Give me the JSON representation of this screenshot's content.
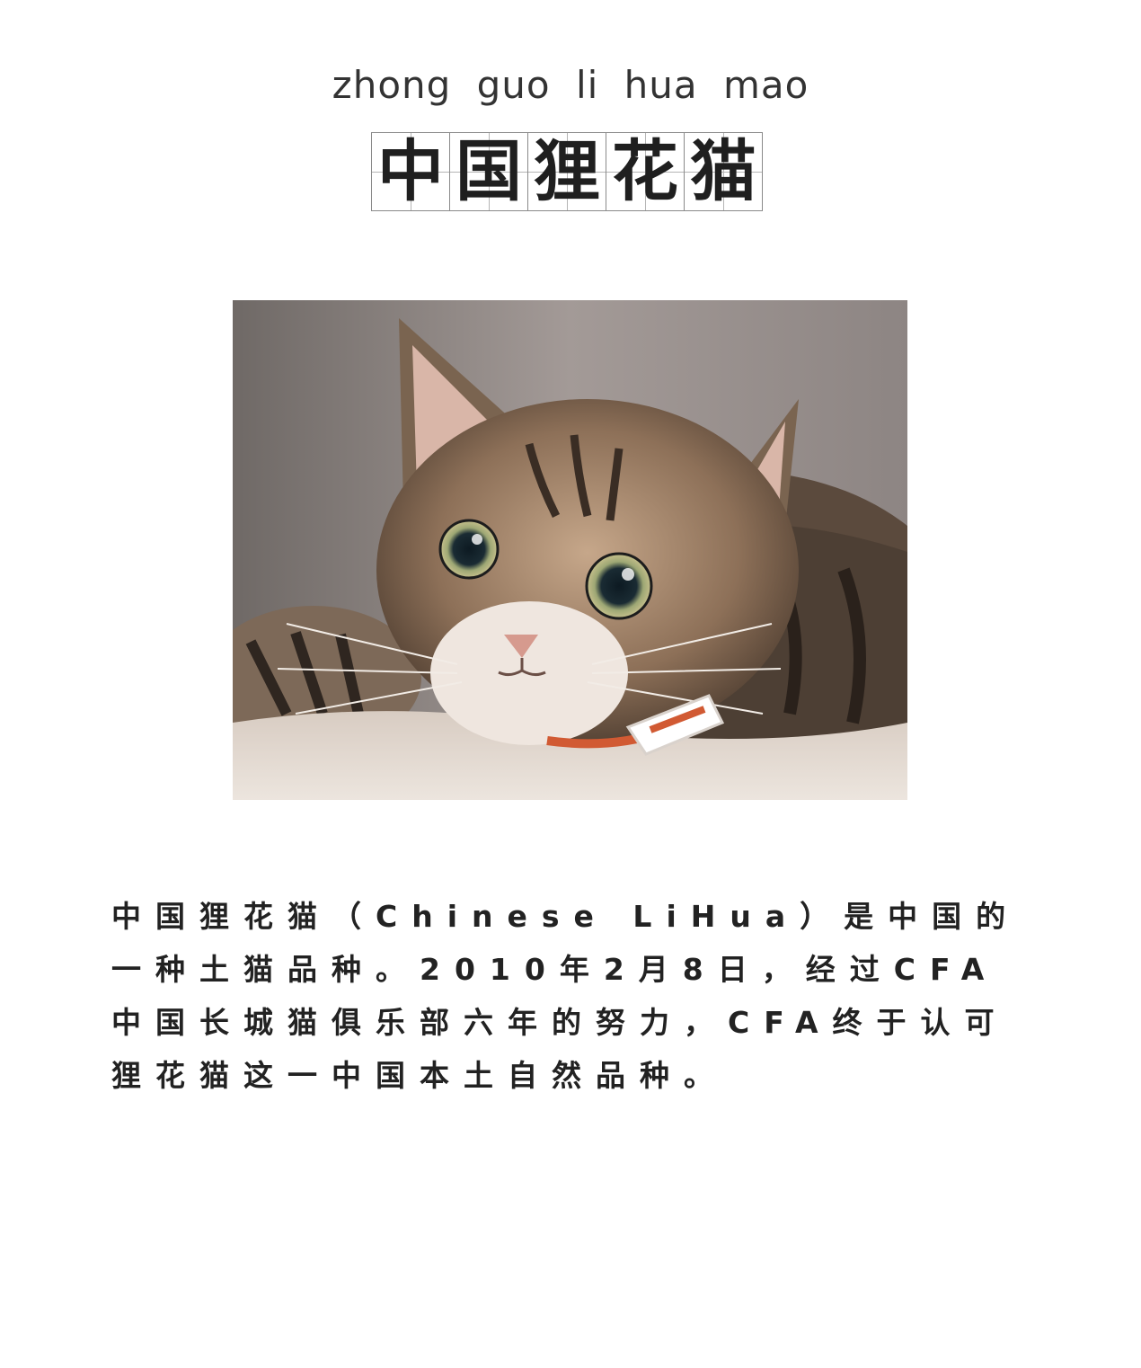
{
  "pinyin": "zhong guo li hua mao",
  "title_chars": [
    "中",
    "国",
    "狸",
    "花",
    "猫"
  ],
  "photo": {
    "subject": "brown tabby cat lying on a blanket, wearing an orange collar with a white tag"
  },
  "description": "中国狸花猫（Chinese LiHua）是中国的一种土猫品种。2010年2月8日，经过CFA中国长城猫俱乐部六年的努力，CFA终于认可狸花猫这一中国本土自然品种。"
}
